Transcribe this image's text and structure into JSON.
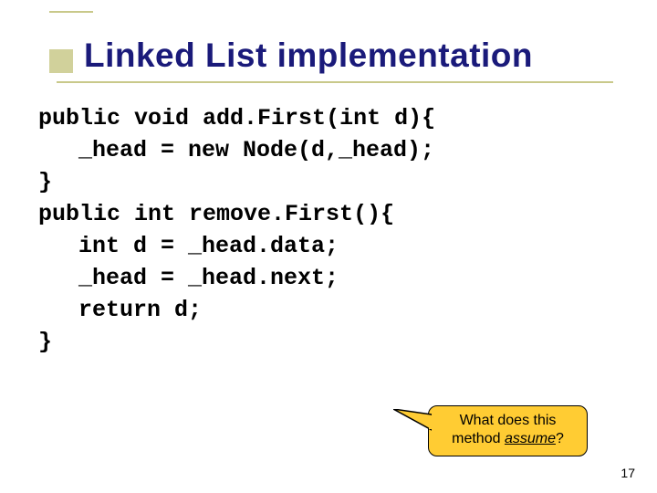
{
  "title": "Linked List implementation",
  "code": {
    "line1a": "public void ",
    "line1b": "add.First",
    "line1c": "(int d){",
    "line2": "_head = new Node(d,_head);",
    "line3": "}",
    "line4a": "public int ",
    "line4b": "remove.First",
    "line4c": "(){",
    "line5": "int d = _head.data;",
    "line6": "_head = _head.next;",
    "line7": "return d;",
    "line8": "}"
  },
  "callout": {
    "line1": "What does this",
    "line2a": "method ",
    "line2b": "assume",
    "line2c": "?"
  },
  "page": "17"
}
